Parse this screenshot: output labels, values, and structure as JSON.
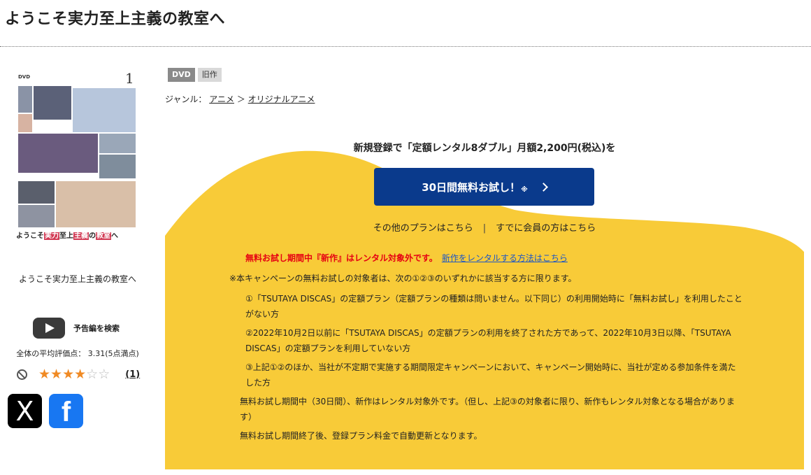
{
  "page": {
    "title": "ようこそ実力至上主義の教室へ"
  },
  "jacket": {
    "dvd_mark": "DVD",
    "volume": "1",
    "strip_pre": "ようこそ",
    "strip_hl1": "実力",
    "strip_mid": "至上",
    "strip_hl2": "主義",
    "strip_post": "の",
    "strip_hl3": "教室",
    "strip_end": "へ",
    "caption": "ようこそ実力至上主義の教室へ"
  },
  "trailer": {
    "label": "予告編を検索"
  },
  "rating": {
    "avg_text": "全体の平均評価点： 3.31(5点満点)",
    "stars_full": "★★★",
    "stars_half": "★",
    "stars_empty": "☆☆",
    "open_paren": "(",
    "count": "1",
    "close_paren": ")"
  },
  "sns": {
    "x_label": "X",
    "fb_label": "f"
  },
  "product": {
    "badge_dvd": "DVD",
    "badge_old": "旧作",
    "genre_prefix": "ジャンル：",
    "genre_1": "アニメ",
    "genre_arrow": "＞",
    "genre_2": "オリジナルアニメ"
  },
  "campaign": {
    "promo": "新規登録で「定額レンタル8ダブル」月額2,200円(税込)を",
    "cta_label": "30日間無料お試し！",
    "cta_mark": "※",
    "other_plans": "その他のプランはこちら",
    "separator": "|",
    "member_link": "すでに会員の方はこちら",
    "notice_red": "無料お試し期間中『新作』はレンタル対象外です。",
    "notice_link": "新作をレンタルする方法はこちら",
    "lead": "※本キャンペーンの無料お試しの対象者は、次の①②③のいずれかに該当する方に限ります。",
    "term_1": "①「TSUTAYA DISCAS」の定額プラン（定額プランの種類は問いません。以下同じ）の利用開始時に「無料お試し」を利用したことがない方",
    "term_2": "②2022年10月2日以前に「TSUTAYA DISCAS」の定額プランの利用を終了された方であって、2022年10月3日以降、「TSUTAYA DISCAS」の定額プランを利用していない方",
    "term_3": "③上記①②のほか、当社が不定期で実施する期間限定キャンペーンにおいて、キャンペーン開始時に、当社が定める参加条件を満たした方",
    "note_1": "無料お試し期間中（30日間）、新作はレンタル対象外です。（但し、上記③の対象者に限り、新作もレンタル対象となる場合があります）",
    "note_2": "無料お試し期間終了後、登録プラン料金で自動更新となります。"
  },
  "colors": {
    "campaign_yellow": "#f8cb38",
    "cta_blue": "#0a3a8c",
    "notice_red": "#e60012",
    "link_blue": "#1a55c8",
    "star_orange": "#f08a24"
  }
}
